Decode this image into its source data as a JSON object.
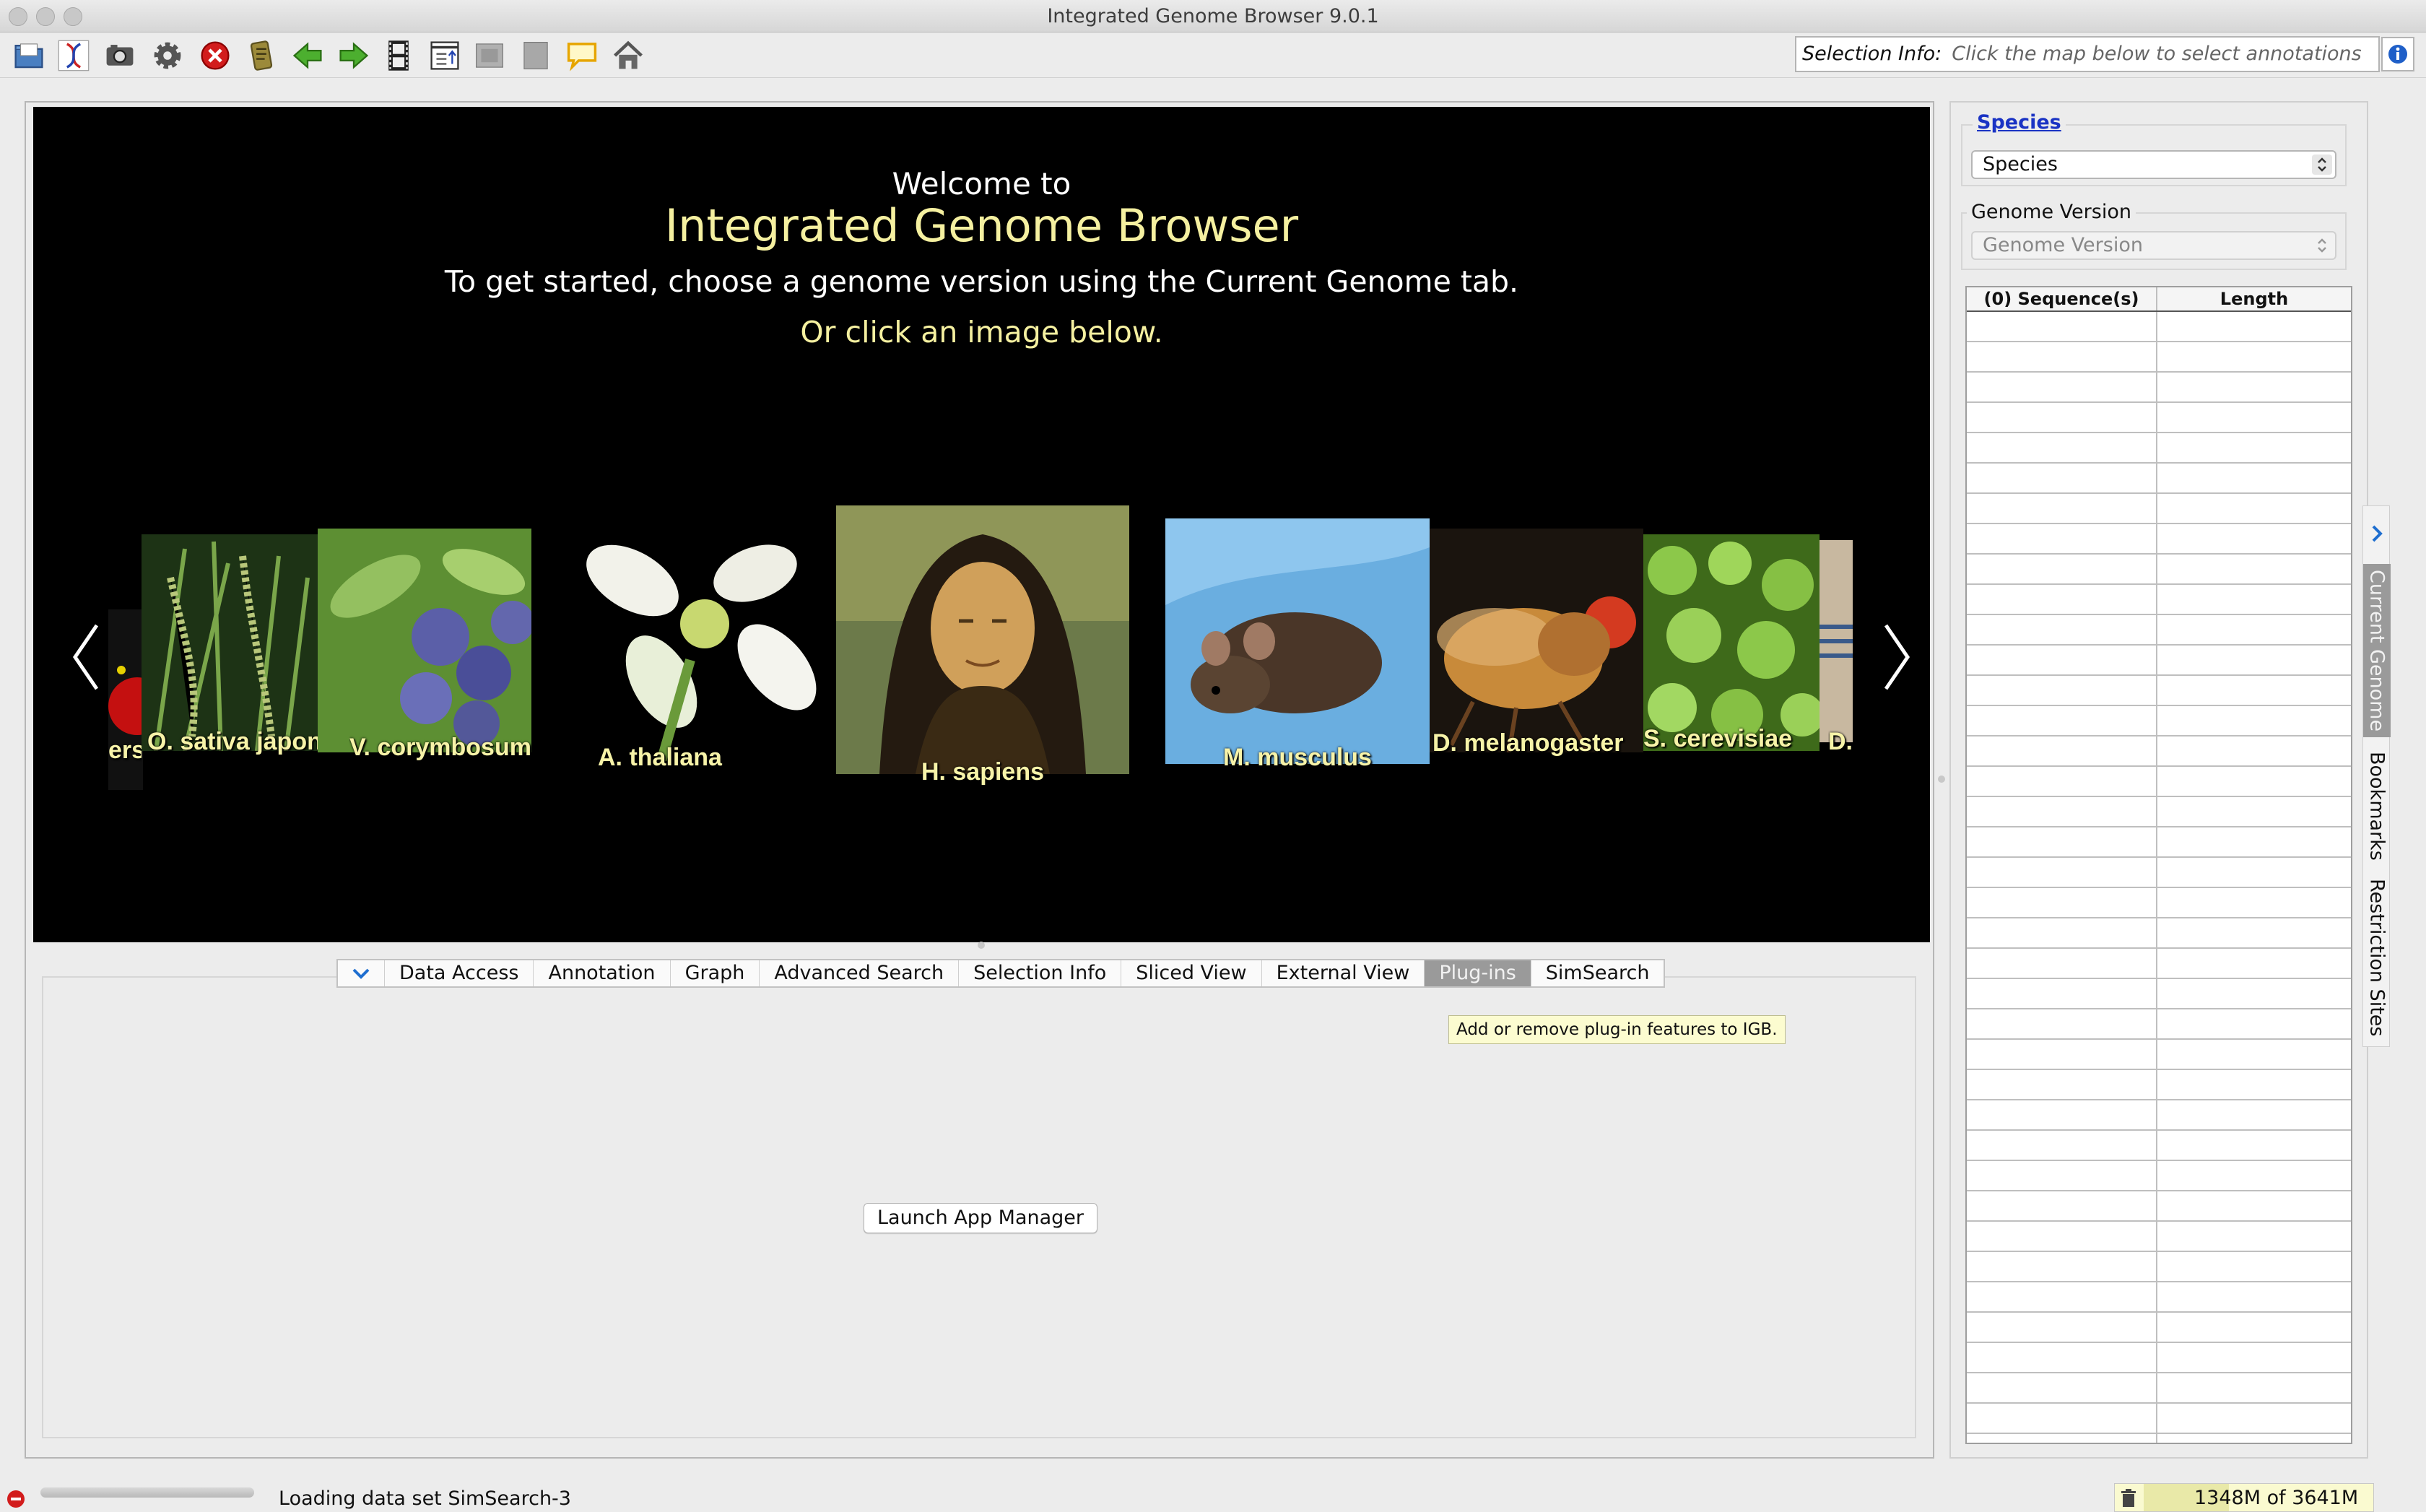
{
  "window": {
    "title": "Integrated Genome Browser 9.0.1"
  },
  "toolbar": {
    "buttons": [
      {
        "icon": "open-folder-icon"
      },
      {
        "icon": "dna-icon"
      },
      {
        "icon": "camera-icon"
      },
      {
        "icon": "gear-icon"
      },
      {
        "icon": "stop-icon"
      },
      {
        "icon": "script-icon"
      },
      {
        "icon": "back-arrow-icon"
      },
      {
        "icon": "forward-arrow-icon"
      },
      {
        "icon": "film-icon"
      },
      {
        "icon": "export-icon"
      },
      {
        "icon": "window-icon"
      },
      {
        "icon": "panel-icon"
      },
      {
        "icon": "speech-bubble-icon"
      },
      {
        "icon": "home-icon"
      }
    ],
    "selection_info_label": "Selection Info:",
    "selection_info_value": "Click the map below to select annotations"
  },
  "welcome": {
    "line1": "Welcome to",
    "line2": "Integrated Genome Browser",
    "line3": "To get started, choose a genome version using the Current Genome tab.",
    "line4": "Or click an image below."
  },
  "carousel": [
    {
      "label": "ersi"
    },
    {
      "label": "O. sativa japon"
    },
    {
      "label": "V. corymbosum"
    },
    {
      "label": "A. thaliana"
    },
    {
      "label": "H. sapiens"
    },
    {
      "label": "M. musculus"
    },
    {
      "label": "D. melanogaster"
    },
    {
      "label": "S. cerevisiae"
    },
    {
      "label": "D. r"
    }
  ],
  "tabs": [
    {
      "label": "Data Access"
    },
    {
      "label": "Annotation"
    },
    {
      "label": "Graph"
    },
    {
      "label": "Advanced Search"
    },
    {
      "label": "Selection Info"
    },
    {
      "label": "Sliced View"
    },
    {
      "label": "External View"
    },
    {
      "label": "Plug-ins",
      "selected": true
    },
    {
      "label": "SimSearch"
    }
  ],
  "tooltip": "Add or remove plug-in features to IGB.",
  "plugins": {
    "launch_label": "Launch App Manager"
  },
  "genome_panel": {
    "species_legend": "Species",
    "species_value": "Species",
    "version_legend": "Genome Version",
    "version_value": "Genome Version",
    "col_sequences": "(0) Sequence(s)",
    "col_length": "Length"
  },
  "side_tabs": [
    {
      "label": "Current Genome",
      "selected": true
    },
    {
      "label": "Bookmarks"
    },
    {
      "label": "Restriction Sites"
    }
  ],
  "status": {
    "text": "Loading data set SimSearch-3",
    "memory": "1348M of 3641M",
    "memory_fraction": 0.37
  },
  "colors": {
    "accent_yellow": "#f5f0a0",
    "link_blue": "#1a33c4",
    "selected_tab": "#9a9a9a"
  }
}
